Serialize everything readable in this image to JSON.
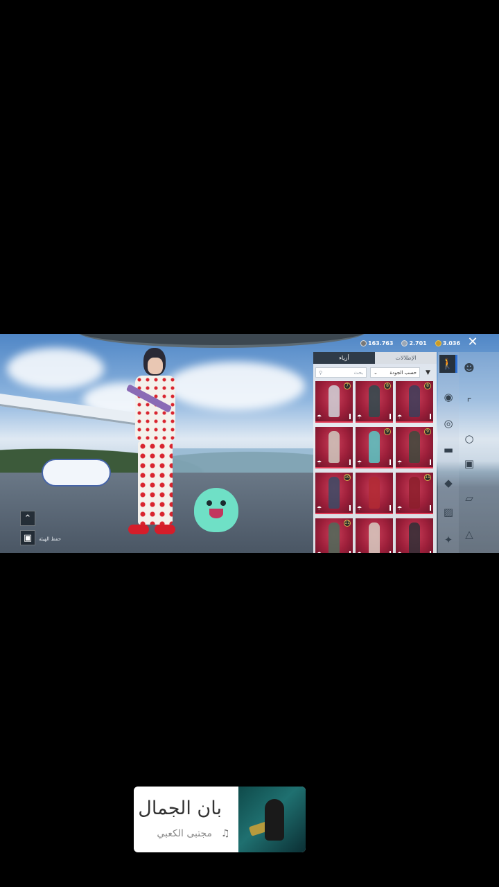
{
  "currency": {
    "silver": "163.763",
    "uc": "2.701",
    "bp": "3.036"
  },
  "panel": {
    "tabs": [
      "الإطلالات",
      "أزياء"
    ],
    "active_tab": 1,
    "search_placeholder": "بحث",
    "sort_label": "حسب الجودة"
  },
  "items": [
    {
      "badge": "7",
      "color": "#cfd2d8"
    },
    {
      "badge": "8",
      "color": "#2d4b4f"
    },
    {
      "badge": "8",
      "color": "#3b3e5a"
    },
    {
      "badge": "",
      "color": "#cfcabf"
    },
    {
      "badge": "9",
      "color": "#58c9c7"
    },
    {
      "badge": "9",
      "color": "#3d4a3d"
    },
    {
      "badge": "10",
      "color": "#3a4b66"
    },
    {
      "badge": "",
      "color": "#b12a34"
    },
    {
      "badge": "11",
      "color": "#8b1f2c"
    },
    {
      "badge": "11",
      "color": "#4e6b5a"
    },
    {
      "badge": "",
      "color": "#d7cdc2"
    },
    {
      "badge": "",
      "color": "#2f2f36"
    }
  ],
  "left_controls": {
    "label": "حفظ الهيئة"
  },
  "categories": [
    "outfit-icon",
    "hat-icon",
    "gun-icon",
    "mask-icon",
    "steering-wheel-icon",
    "vehicle-icon",
    "backpack-icon",
    "coat-icon",
    "box-icon",
    "trophy-icon",
    "parachute-icon"
  ],
  "music": {
    "title": "بان الجمال",
    "artist": "مجتبى الكعبي"
  }
}
